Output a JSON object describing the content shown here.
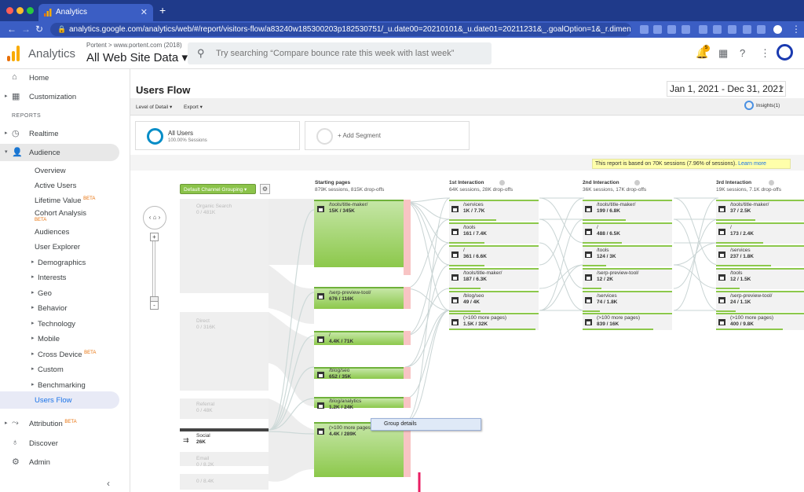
{
  "browser": {
    "tab_title": "Analytics",
    "new_tab": "+",
    "url": "analytics.google.com/analytics/web/#/report/visitors-flow/a83240w185300203p182530751/_u.date00=20210101&_u.date01=20211231&_.goalOption=1&_r.dimension..."
  },
  "app": {
    "name": "Analytics",
    "account": "Portent > www.portent.com (2018)",
    "property": "All Web Site Data ▾",
    "search_placeholder": "Try searching “Compare bounce rate this week with last week”",
    "notification_count": "5"
  },
  "sidebar": {
    "home": "Home",
    "customization": "Customization",
    "reports_label": "REPORTS",
    "realtime": "Realtime",
    "audience": "Audience",
    "items": [
      {
        "label": "Overview"
      },
      {
        "label": "Active Users"
      },
      {
        "label": "Lifetime Value",
        "beta": "BETA"
      },
      {
        "label": "Cohort Analysis",
        "beta": "BETA"
      },
      {
        "label": "Audiences"
      },
      {
        "label": "User Explorer"
      },
      {
        "label": "Demographics"
      },
      {
        "label": "Interests"
      },
      {
        "label": "Geo"
      },
      {
        "label": "Behavior"
      },
      {
        "label": "Technology"
      },
      {
        "label": "Mobile"
      },
      {
        "label": "Cross Device",
        "beta": "BETA"
      },
      {
        "label": "Custom"
      },
      {
        "label": "Benchmarking"
      },
      {
        "label": "Users Flow"
      }
    ],
    "attribution": "Attribution",
    "attribution_beta": "BETA",
    "discover": "Discover",
    "admin": "Admin"
  },
  "report": {
    "title": "Users Flow",
    "date_range": "Jan 1, 2021 - Dec 31, 2021",
    "level_of_detail": "Level of Detail ▾",
    "export": "Export ▾",
    "insights": "Insights(1)",
    "segments": [
      {
        "name": "All Users",
        "sub": "100.00% Sessions"
      },
      {
        "name": "+ Add Segment",
        "sub": ""
      }
    ],
    "notice": "This report is based on 70K sessions (7.96% of sessions).",
    "notice_link": "Learn more",
    "dimension": "Default Channel Grouping ▾"
  },
  "flow": {
    "columns": [
      {
        "title": "Starting pages",
        "stats": "879K sessions, 815K drop-offs"
      },
      {
        "title": "1st Interaction",
        "stats": "64K sessions, 28K drop-offs"
      },
      {
        "title": "2nd Interaction",
        "stats": "36K sessions, 17K drop-offs"
      },
      {
        "title": "3rd Interaction",
        "stats": "19K sessions, 7.1K drop-offs"
      }
    ],
    "sources": [
      {
        "name": "Organic Search",
        "value": "0 / 481K"
      },
      {
        "name": "Direct",
        "value": "0 / 316K"
      },
      {
        "name": "Referral",
        "value": "0 / 48K"
      },
      {
        "name": "Social",
        "value": "26K"
      },
      {
        "name": "Email",
        "value": "0 / 8.2K"
      },
      {
        "name": "",
        "value": "0 / 8.4K"
      }
    ],
    "starting_pages": [
      {
        "name": "/tools/title-maker/",
        "value": "15K / 345K"
      },
      {
        "name": "/serp-preview-tool/",
        "value": "676 / 116K"
      },
      {
        "name": "/",
        "value": "4.4K / 71K"
      },
      {
        "name": "/blog/seo",
        "value": "652 / 35K"
      },
      {
        "name": "/blog/analytics",
        "value": "1.2K / 24K"
      },
      {
        "name": "(>100 more pages)",
        "value": "4.4K / 289K"
      }
    ],
    "first": [
      {
        "name": "/services",
        "value": "1K / 7.7K"
      },
      {
        "name": "/tools",
        "value": "161 / 7.4K"
      },
      {
        "name": "/",
        "value": "361 / 6.6K"
      },
      {
        "name": "/tools/title-maker/",
        "value": "187 / 6.3K"
      },
      {
        "name": "/blog/seo",
        "value": "49 / 4K"
      },
      {
        "name": "(>100 more pages)",
        "value": "1.5K / 32K"
      }
    ],
    "second": [
      {
        "name": "/tools/title-maker/",
        "value": "199 / 6.8K"
      },
      {
        "name": "/",
        "value": "488 / 6.5K"
      },
      {
        "name": "/tools",
        "value": "124 / 3K"
      },
      {
        "name": "/serp-preview-tool/",
        "value": "12 / 2K"
      },
      {
        "name": "/services",
        "value": "74 / 1.8K"
      },
      {
        "name": "(>100 more pages)",
        "value": "839 / 16K"
      }
    ],
    "third": [
      {
        "name": "/tools/title-maker/",
        "value": "37 / 2.5K"
      },
      {
        "name": "/",
        "value": "173 / 2.4K"
      },
      {
        "name": "/services",
        "value": "237 / 1.8K"
      },
      {
        "name": "/tools",
        "value": "12 / 1.5K"
      },
      {
        "name": "/serp-preview-tool/",
        "value": "24 / 1.1K"
      },
      {
        "name": "(>100 more pages)",
        "value": "400 / 9.8K"
      }
    ],
    "context_menu": "Group details"
  },
  "colors": {
    "accent": "#8cc84b",
    "highlight_arrow": "#e91e63",
    "chrome": "#3b5ec4"
  }
}
